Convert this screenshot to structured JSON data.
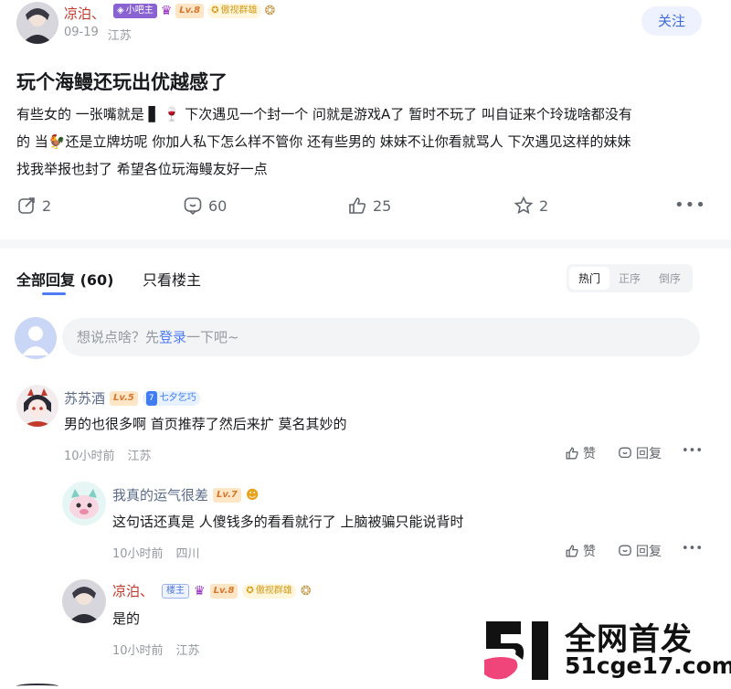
{
  "post": {
    "author": "凉泊、",
    "badge_bar": "小吧主",
    "level": "Lv.8",
    "badge_title": "傲视群雄",
    "date": "09-19",
    "location": "江苏",
    "follow_label": "关注",
    "title": "玩个海鳗还玩出优越感了",
    "line1": "有些女的 一张嘴就是 ▋ 🍷 下次遇见一个封一个 问就是游戏A了 暂时不玩了 叫自证来个玲珑啥都没有",
    "line2": "的 当🐓还是立牌坊呢 你加人私下怎么样不管你 还有些男的 妹妹不让你看就骂人 下次遇见这样的妹妹",
    "line3": "找我举报也封了 希望各位玩海鳗友好一点",
    "share_count": "2",
    "comment_count": "60",
    "like_count": "25",
    "fav_count": "2"
  },
  "replies_header": {
    "tab_all": "全部回复 (60)",
    "tab_host": "只看楼主",
    "sort_hot": "热门",
    "sort_asc": "正序",
    "sort_desc": "倒序"
  },
  "reply_input": {
    "prefix": "想说点啥？先",
    "login": "登录",
    "suffix": "一下吧~"
  },
  "comments": [
    {
      "author": "苏苏酒",
      "level": "Lv.5",
      "badge_num": "7",
      "badge_title": "七夕乞巧",
      "text": "男的也很多啊 首页推荐了然后来扩 莫名其妙的",
      "time": "10小时前",
      "location": "江苏",
      "like_label": "赞",
      "reply_label": "回复"
    },
    {
      "author": "我真的运气很差",
      "level": "Lv.7",
      "text": "这句话还真是 人傻钱多的看看就行了 上脑被骗只能说背时",
      "time": "10小时前",
      "location": "四川",
      "like_label": "赞",
      "reply_label": "回复"
    },
    {
      "author": "凉泊、",
      "host_badge": "楼主",
      "level": "Lv.8",
      "badge_title": "傲视群雄",
      "text": "是的",
      "time": "10小时前",
      "location": "江苏"
    }
  ],
  "watermark": {
    "logo_text": "51",
    "title": "全网首发",
    "url": "51cge17.com"
  },
  "colors": {
    "accent": "#4f7cf5",
    "author_red": "#c0392b",
    "divider": "#f6f7f8"
  }
}
